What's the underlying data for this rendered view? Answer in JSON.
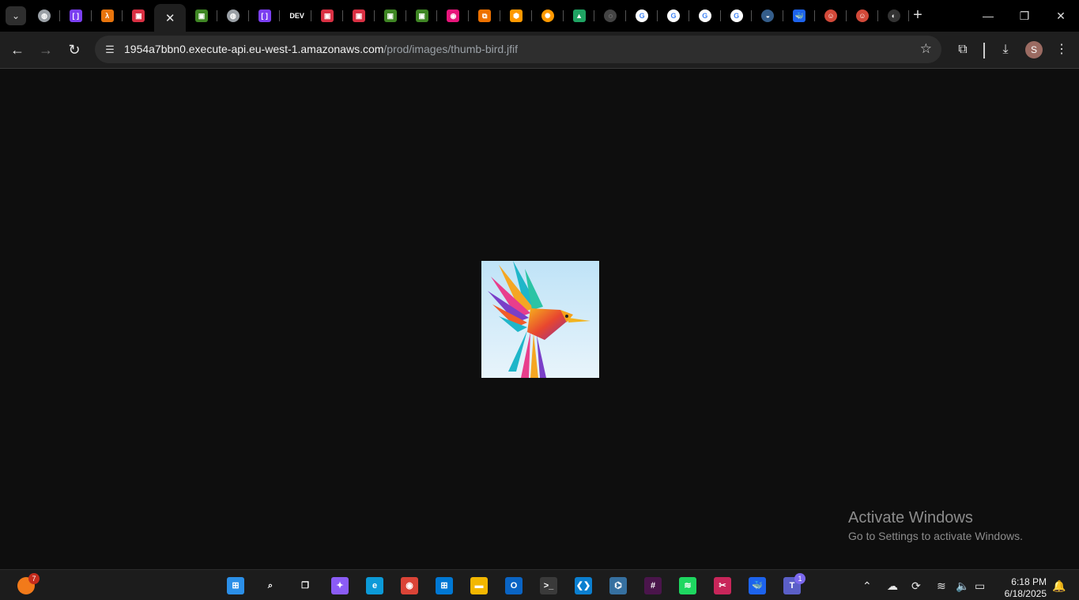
{
  "browser": {
    "active_tab_close": "✕",
    "new_tab": "+",
    "controls": {
      "minimize": "—",
      "maximize": "❐",
      "close": "✕"
    }
  },
  "tabs": [
    {
      "name": "tab-globe-1",
      "icon": "globe-icon",
      "glyph": "◍",
      "color": "#9aa0a6",
      "round": true
    },
    {
      "name": "tab-lambda-purple-1",
      "icon": "bracket-logo-icon",
      "glyph": "[ ]",
      "color": "#7b3ff2"
    },
    {
      "name": "tab-lambda-orange",
      "icon": "aws-lambda-icon",
      "glyph": "λ",
      "color": "#e8740c"
    },
    {
      "name": "tab-aws-red-1",
      "icon": "aws-red-service-icon",
      "glyph": "▣",
      "color": "#d93043"
    },
    {
      "name": "tab-active",
      "icon": "close-icon",
      "active": true
    },
    {
      "name": "tab-aws-green-1",
      "icon": "aws-green-service-icon",
      "glyph": "▣",
      "color": "#3f8624"
    },
    {
      "name": "tab-globe-2",
      "icon": "globe-icon",
      "glyph": "◍",
      "color": "#9aa0a6",
      "round": true
    },
    {
      "name": "tab-lambda-purple-2",
      "icon": "bracket-logo-icon",
      "glyph": "[ ]",
      "color": "#7b3ff2"
    },
    {
      "name": "tab-dev",
      "icon": "dev-logo-icon",
      "glyph": "DEV",
      "color": "#000000"
    },
    {
      "name": "tab-aws-red-2",
      "icon": "aws-red-service-icon",
      "glyph": "▣",
      "color": "#d93043"
    },
    {
      "name": "tab-aws-red-3",
      "icon": "aws-red-service-icon",
      "glyph": "▣",
      "color": "#d93043"
    },
    {
      "name": "tab-aws-green-2",
      "icon": "aws-green-service-icon",
      "glyph": "▣",
      "color": "#3f8624"
    },
    {
      "name": "tab-aws-green-3",
      "icon": "aws-green-service-icon",
      "glyph": "▣",
      "color": "#3f8624"
    },
    {
      "name": "tab-aws-pink",
      "icon": "aws-pink-service-icon",
      "glyph": "◉",
      "color": "#e7157b"
    },
    {
      "name": "tab-aws-orange-1",
      "icon": "aws-orange-service-icon",
      "glyph": "⧉",
      "color": "#ed7100"
    },
    {
      "name": "tab-aws-orange-2",
      "icon": "aws-cube-icon",
      "glyph": "⬢",
      "color": "#ff9900"
    },
    {
      "name": "tab-gear-orange",
      "icon": "gear-logo-icon",
      "glyph": "✺",
      "color": "#ff9900",
      "round": true
    },
    {
      "name": "tab-drive",
      "icon": "google-drive-icon",
      "glyph": "▲",
      "color": "#1fa463"
    },
    {
      "name": "tab-loading",
      "icon": "loading-spinner-icon",
      "glyph": "◌",
      "color": "#444444",
      "round": true
    },
    {
      "name": "tab-google-1",
      "icon": "google-icon",
      "glyph": "G",
      "color": "#ffffff",
      "round": true
    },
    {
      "name": "tab-google-2",
      "icon": "google-icon",
      "glyph": "G",
      "color": "#ffffff",
      "round": true
    },
    {
      "name": "tab-google-3",
      "icon": "google-icon",
      "glyph": "G",
      "color": "#ffffff",
      "round": true
    },
    {
      "name": "tab-google-4",
      "icon": "google-icon",
      "glyph": "G",
      "color": "#ffffff",
      "round": true
    },
    {
      "name": "tab-docker-gray",
      "icon": "docker-dim-icon",
      "glyph": "◒",
      "color": "#345d8a",
      "round": true
    },
    {
      "name": "tab-docker",
      "icon": "docker-icon",
      "glyph": "🐳",
      "color": "#1d63ed"
    },
    {
      "name": "tab-jenkins-1",
      "icon": "jenkins-icon",
      "glyph": "☺",
      "color": "#d24939",
      "round": true
    },
    {
      "name": "tab-jenkins-2",
      "icon": "jenkins-icon",
      "glyph": "☺",
      "color": "#d24939",
      "round": true
    },
    {
      "name": "tab-github",
      "icon": "github-icon",
      "glyph": "◐",
      "color": "#333333",
      "round": true
    }
  ],
  "toolbar": {
    "url_host": "1954a7bbn0.execute-api.eu-west-1.amazonaws.com",
    "url_path": "/prod/images/thumb-bird.jfif",
    "avatar_initial": "S"
  },
  "watermark": {
    "title": "Activate Windows",
    "subtitle": "Go to Settings to activate Windows."
  },
  "taskbar": {
    "widgets_badge": "7",
    "teams_badge": "1",
    "time": "6:18 PM",
    "date": "6/18/2025",
    "apps": [
      {
        "name": "start-button",
        "icon": "windows-logo-icon",
        "glyph": "⊞",
        "color": "#2b8fe8"
      },
      {
        "name": "search-button",
        "icon": "search-icon",
        "glyph": "⌕",
        "color": "transparent"
      },
      {
        "name": "task-view-button",
        "icon": "task-view-icon",
        "glyph": "❐",
        "color": "transparent"
      },
      {
        "name": "copilot-button",
        "icon": "copilot-icon",
        "glyph": "✦",
        "color": "#8b5cf6"
      },
      {
        "name": "edge-button",
        "icon": "edge-icon",
        "glyph": "e",
        "color": "#0c9ad8"
      },
      {
        "name": "chrome-button",
        "icon": "chrome-icon",
        "glyph": "◉",
        "color": "#db4437"
      },
      {
        "name": "store-button",
        "icon": "microsoft-store-icon",
        "glyph": "⊞",
        "color": "#0078d4"
      },
      {
        "name": "file-explorer-button",
        "icon": "folder-icon",
        "glyph": "▬",
        "color": "#f3b700"
      },
      {
        "name": "outlook-button",
        "icon": "outlook-icon",
        "glyph": "O",
        "color": "#0a64c4"
      },
      {
        "name": "terminal-button",
        "icon": "terminal-icon",
        "glyph": ">_",
        "color": "#3a3a3a"
      },
      {
        "name": "vscode-button",
        "icon": "vscode-icon",
        "glyph": "❮❯",
        "color": "#0b7fd0"
      },
      {
        "name": "python-button",
        "icon": "python-icon",
        "glyph": "⌬",
        "color": "#3670a0"
      },
      {
        "name": "slack-button",
        "icon": "slack-icon",
        "glyph": "#",
        "color": "#4a154b"
      },
      {
        "name": "spotify-button",
        "icon": "spotify-icon",
        "glyph": "≋",
        "color": "#1ed760"
      },
      {
        "name": "snipping-tool-button",
        "icon": "snipping-tool-icon",
        "glyph": "✂",
        "color": "#c8265a"
      },
      {
        "name": "docker-desktop-button",
        "icon": "docker-icon",
        "glyph": "🐳",
        "color": "#1d63ed"
      },
      {
        "name": "teams-button",
        "icon": "teams-icon",
        "glyph": "T",
        "color": "#5b5fc7"
      }
    ],
    "tray": [
      {
        "name": "show-hidden-icons",
        "icon": "chevron-up-icon",
        "glyph": "⌃"
      },
      {
        "name": "onedrive-tray",
        "icon": "cloud-icon",
        "glyph": "☁"
      },
      {
        "name": "sync-tray",
        "icon": "sync-icon",
        "glyph": "⟳"
      },
      {
        "name": "wifi-tray",
        "icon": "wifi-icon",
        "glyph": "≋"
      },
      {
        "name": "volume-tray",
        "icon": "speaker-icon",
        "glyph": "🔈"
      },
      {
        "name": "battery-tray",
        "icon": "battery-icon",
        "glyph": "▭"
      }
    ]
  },
  "colors": {
    "page_bg": "#0e0e0e",
    "toolbar_bg": "#1f1f1f",
    "tabbar_bg": "#000000",
    "taskbar_bg": "#1c1c1c"
  }
}
